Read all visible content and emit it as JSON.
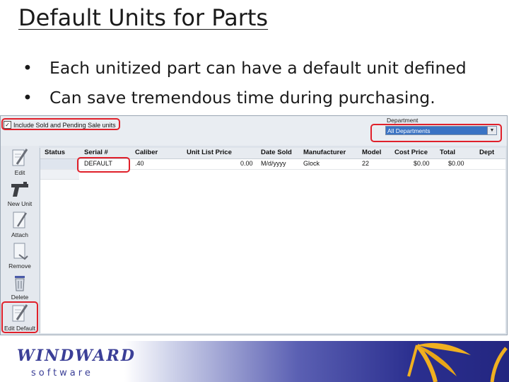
{
  "slide": {
    "title": "Default Units for Parts",
    "bullets": [
      "Each unitized part can have a default unit defined",
      "Can save tremendous time during purchasing."
    ]
  },
  "app": {
    "include_checkbox": {
      "label": "Include Sold and Pending Sale units",
      "checked": true
    },
    "department": {
      "label": "Department",
      "selected": "All Departments"
    },
    "toolbar": [
      {
        "label": "Edit",
        "icon": "edit-pencil-icon"
      },
      {
        "label": "New Unit",
        "icon": "gun-icon"
      },
      {
        "label": "Attach",
        "icon": "attach-icon"
      },
      {
        "label": "Remove",
        "icon": "remove-icon"
      },
      {
        "label": "Delete",
        "icon": "trash-icon"
      },
      {
        "label": "Edit Default",
        "icon": "edit-pencil-icon"
      }
    ],
    "columns": [
      "Status",
      "Serial #",
      "Caliber",
      "Unit List Price",
      "Date Sold",
      "Manufacturer",
      "Model",
      "Cost Price",
      "Total",
      "Dept"
    ],
    "rows": [
      {
        "status": "",
        "serial": "DEFAULT",
        "caliber": ".40",
        "unit_list_price": "0.00",
        "date_sold": "M/d/yyyy",
        "manufacturer": "Glock",
        "model": "22",
        "cost_price": "$0.00",
        "total": "$0.00",
        "dept": ""
      }
    ]
  },
  "footer": {
    "logo_main": "WINDWARD",
    "logo_sub": "software"
  },
  "colors": {
    "highlight": "#e0202a",
    "brand": "#3b3f97",
    "selection": "#3a73c4"
  }
}
